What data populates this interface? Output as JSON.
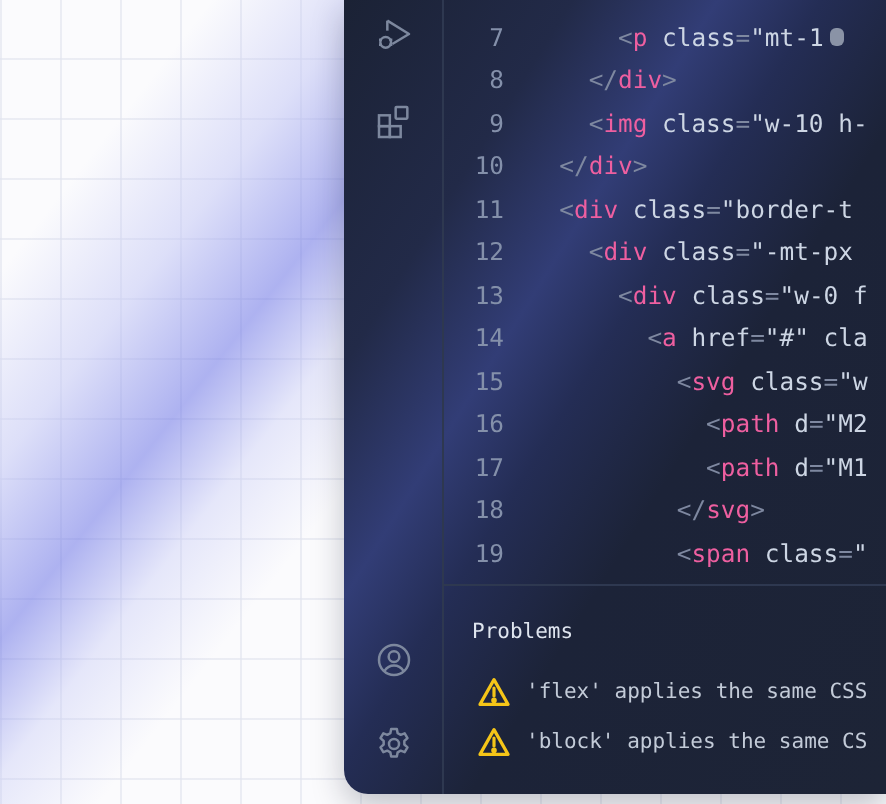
{
  "activity_bar": {
    "top_items": [
      {
        "kind": "debug"
      },
      {
        "kind": "extensions"
      }
    ],
    "bottom_items": [
      {
        "kind": "account"
      },
      {
        "kind": "settings"
      }
    ]
  },
  "editor": {
    "lines": [
      {
        "number": "7",
        "marker": true,
        "tokens": [
          {
            "kind": "punct",
            "text": "      <"
          },
          {
            "kind": "tag",
            "text": "p"
          },
          {
            "kind": "attr",
            "text": " class"
          },
          {
            "kind": "punct",
            "text": "="
          },
          {
            "kind": "string",
            "text": "\"mt-1"
          }
        ]
      },
      {
        "number": "8",
        "marker": false,
        "tokens": [
          {
            "kind": "punct",
            "text": "    </"
          },
          {
            "kind": "tag",
            "text": "div"
          },
          {
            "kind": "punct",
            "text": ">"
          }
        ]
      },
      {
        "number": "9",
        "marker": false,
        "tokens": [
          {
            "kind": "punct",
            "text": "    <"
          },
          {
            "kind": "tag",
            "text": "img"
          },
          {
            "kind": "attr",
            "text": " class"
          },
          {
            "kind": "punct",
            "text": "="
          },
          {
            "kind": "string",
            "text": "\"w-10 h-"
          }
        ]
      },
      {
        "number": "10",
        "marker": false,
        "tokens": [
          {
            "kind": "punct",
            "text": "  </"
          },
          {
            "kind": "tag",
            "text": "div"
          },
          {
            "kind": "punct",
            "text": ">"
          }
        ]
      },
      {
        "number": "11",
        "marker": false,
        "tokens": [
          {
            "kind": "punct",
            "text": "  <"
          },
          {
            "kind": "tag",
            "text": "div"
          },
          {
            "kind": "attr",
            "text": " class"
          },
          {
            "kind": "punct",
            "text": "="
          },
          {
            "kind": "string",
            "text": "\"border-t"
          }
        ]
      },
      {
        "number": "12",
        "marker": false,
        "tokens": [
          {
            "kind": "punct",
            "text": "    <"
          },
          {
            "kind": "tag",
            "text": "div"
          },
          {
            "kind": "attr",
            "text": " class"
          },
          {
            "kind": "punct",
            "text": "="
          },
          {
            "kind": "string",
            "text": "\"-mt-px"
          }
        ]
      },
      {
        "number": "13",
        "marker": false,
        "tokens": [
          {
            "kind": "punct",
            "text": "      <"
          },
          {
            "kind": "tag",
            "text": "div"
          },
          {
            "kind": "attr",
            "text": " class"
          },
          {
            "kind": "punct",
            "text": "="
          },
          {
            "kind": "string",
            "text": "\"w-0 f"
          }
        ]
      },
      {
        "number": "14",
        "marker": false,
        "tokens": [
          {
            "kind": "punct",
            "text": "        <"
          },
          {
            "kind": "tag",
            "text": "a"
          },
          {
            "kind": "attr",
            "text": " href"
          },
          {
            "kind": "punct",
            "text": "="
          },
          {
            "kind": "string",
            "text": "\"#\""
          },
          {
            "kind": "attr",
            "text": " cla"
          }
        ]
      },
      {
        "number": "15",
        "marker": false,
        "tokens": [
          {
            "kind": "punct",
            "text": "          <"
          },
          {
            "kind": "tag",
            "text": "svg"
          },
          {
            "kind": "attr",
            "text": " class"
          },
          {
            "kind": "punct",
            "text": "="
          },
          {
            "kind": "string",
            "text": "\"w"
          }
        ]
      },
      {
        "number": "16",
        "marker": false,
        "tokens": [
          {
            "kind": "punct",
            "text": "            <"
          },
          {
            "kind": "tag",
            "text": "path"
          },
          {
            "kind": "attr",
            "text": " d"
          },
          {
            "kind": "punct",
            "text": "="
          },
          {
            "kind": "string",
            "text": "\"M2"
          }
        ]
      },
      {
        "number": "17",
        "marker": false,
        "tokens": [
          {
            "kind": "punct",
            "text": "            <"
          },
          {
            "kind": "tag",
            "text": "path"
          },
          {
            "kind": "attr",
            "text": " d"
          },
          {
            "kind": "punct",
            "text": "="
          },
          {
            "kind": "string",
            "text": "\"M1"
          }
        ]
      },
      {
        "number": "18",
        "marker": false,
        "tokens": [
          {
            "kind": "punct",
            "text": "          </"
          },
          {
            "kind": "tag",
            "text": "svg"
          },
          {
            "kind": "punct",
            "text": ">"
          }
        ]
      },
      {
        "number": "19",
        "marker": false,
        "tokens": [
          {
            "kind": "punct",
            "text": "          <"
          },
          {
            "kind": "tag",
            "text": "span"
          },
          {
            "kind": "attr",
            "text": " class"
          },
          {
            "kind": "punct",
            "text": "="
          },
          {
            "kind": "string",
            "text": "\""
          }
        ]
      }
    ]
  },
  "problems": {
    "title": "Problems",
    "items": [
      {
        "kind": "warning",
        "message": "'flex' applies the same CSS"
      },
      {
        "kind": "warning",
        "message": "'block' applies the same CS"
      }
    ]
  }
}
